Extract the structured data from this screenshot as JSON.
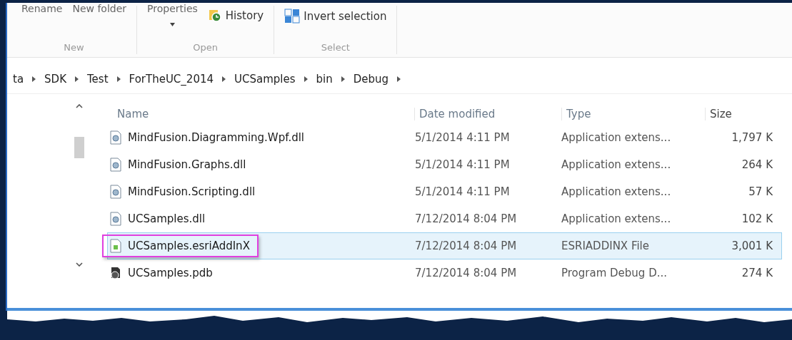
{
  "ribbon": {
    "cut_buttons": [
      "Rename",
      "New folder",
      "Properties"
    ],
    "buttons": [
      {
        "label": "History",
        "kind": "history"
      },
      {
        "label": "Invert selection",
        "kind": "invert"
      }
    ],
    "groups": [
      "New",
      "Open",
      "Select"
    ]
  },
  "breadcrumb": [
    "ta",
    "SDK",
    "Test",
    "ForTheUC_2014",
    "UCSamples",
    "bin",
    "Debug"
  ],
  "table": {
    "columns": [
      "Name",
      "Date modified",
      "Type",
      "Size"
    ],
    "rows": [
      {
        "name": "MindFusion.Diagramming.Wpf.dll",
        "date": "5/1/2014 4:11 PM",
        "type": "Application extens...",
        "size": "1,797 K",
        "kind": "dll",
        "selected": false,
        "annotated": false
      },
      {
        "name": "MindFusion.Graphs.dll",
        "date": "5/1/2014 4:11 PM",
        "type": "Application extens...",
        "size": "264 K",
        "kind": "dll",
        "selected": false,
        "annotated": false
      },
      {
        "name": "MindFusion.Scripting.dll",
        "date": "5/1/2014 4:11 PM",
        "type": "Application extens...",
        "size": "57 K",
        "kind": "dll",
        "selected": false,
        "annotated": false
      },
      {
        "name": "UCSamples.dll",
        "date": "7/12/2014 8:04 PM",
        "type": "Application extens...",
        "size": "102 K",
        "kind": "dll",
        "selected": false,
        "annotated": false
      },
      {
        "name": "UCSamples.esriAddInX",
        "date": "7/12/2014 8:04 PM",
        "type": "ESRIADDINX File",
        "size": "3,001 K",
        "kind": "addin",
        "selected": true,
        "annotated": true
      },
      {
        "name": "UCSamples.pdb",
        "date": "7/12/2014 8:04 PM",
        "type": "Program Debug D...",
        "size": "274 K",
        "kind": "pdb",
        "selected": false,
        "annotated": false
      }
    ]
  }
}
